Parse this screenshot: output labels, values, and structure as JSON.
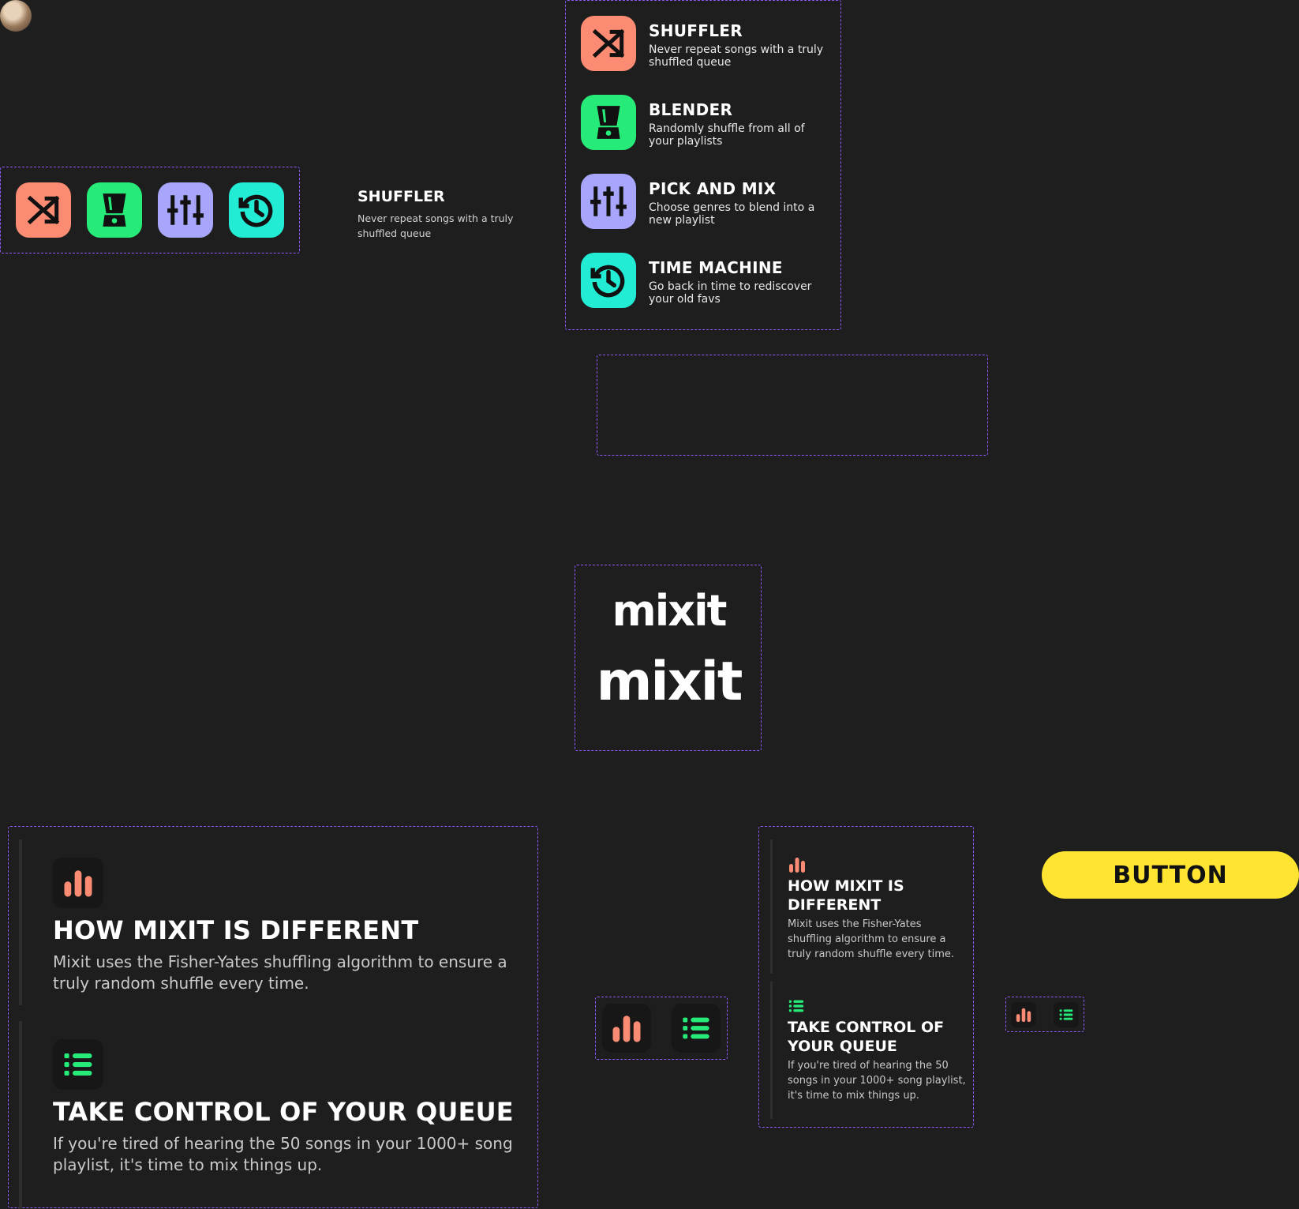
{
  "colors": {
    "background": "#1e1e1e",
    "dashed_border": "#8f5bff",
    "shuffler": "#fb8c73",
    "blender": "#27eb79",
    "pick_and_mix": "#a7a6fb",
    "time_machine": "#22ecd4",
    "button_yellow": "#ffe431"
  },
  "features": [
    {
      "icon": "shuffle-icon",
      "title": "SHUFFLER",
      "desc": "Never repeat songs with a truly shuffled queue"
    },
    {
      "icon": "blender-icon",
      "title": "BLENDER",
      "desc": "Randomly shuffle from all of your playlists"
    },
    {
      "icon": "sliders-icon",
      "title": "PICK AND MIX",
      "desc": "Choose genres to blend into a new playlist"
    },
    {
      "icon": "history-icon",
      "title": "TIME MACHINE",
      "desc": "Go back in time to rediscover your old favs"
    }
  ],
  "selected_feature": {
    "title": "SHUFFLER",
    "desc": "Never repeat songs with a truly shuffled queue"
  },
  "logo": {
    "text": "mixit"
  },
  "info_cards": [
    {
      "icon": "bar-chart-icon",
      "title": "HOW MIXIT IS DIFFERENT",
      "desc": "Mixit uses the Fisher-Yates shuffling algorithm to ensure a truly random shuffle every time."
    },
    {
      "icon": "list-icon",
      "title": "TAKE CONTROL OF YOUR QUEUE",
      "desc": "If you're tired of hearing the 50 songs in your 1000+ song playlist, it's time to mix things up."
    }
  ],
  "button": {
    "label": "BUTTON"
  }
}
